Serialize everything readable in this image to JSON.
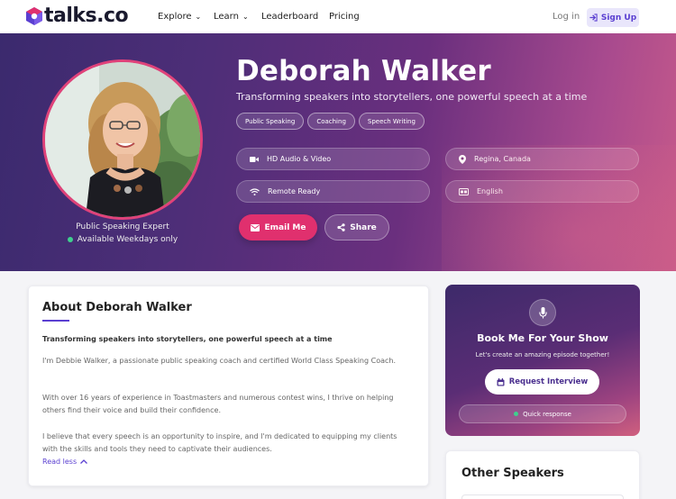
{
  "nav": {
    "logo_text": "talks.co",
    "links": [
      {
        "label": "Explore",
        "has_dropdown": true
      },
      {
        "label": "Learn",
        "has_dropdown": true
      },
      {
        "label": "Leaderboard",
        "has_dropdown": false
      },
      {
        "label": "Pricing",
        "has_dropdown": false
      }
    ],
    "login_label": "Log in",
    "signup_label": "Sign Up"
  },
  "hero": {
    "name": "Deborah Walker",
    "tagline": "Transforming speakers into storytellers, one powerful speech at a time",
    "tags": [
      "Public Speaking",
      "Coaching",
      "Speech Writing"
    ],
    "info": {
      "media": "HD Audio & Video",
      "location": "Regina, Canada",
      "remote": "Remote Ready",
      "language": "English"
    },
    "role": "Public Speaking Expert",
    "availability": "Available Weekdays only",
    "email_label": "Email Me",
    "share_label": "Share"
  },
  "about": {
    "title": "About Deborah Walker",
    "lead": "Transforming speakers into storytellers, one powerful speech at a time",
    "paragraphs": [
      "I'm Debbie Walker, a passionate public speaking coach and certified World Class Speaking Coach.",
      "With over 16 years of experience in Toastmasters and numerous contest wins, I thrive on helping others find their voice and build their confidence.",
      "I believe that every speech is an opportunity to inspire, and I'm dedicated to equipping my clients with the skills and tools they need to captivate their audiences."
    ],
    "read_less_label": "Read less"
  },
  "book": {
    "title": "Book Me For Your Show",
    "subtitle": "Let's create an amazing episode together!",
    "request_label": "Request Interview",
    "quick_label": "Quick response"
  },
  "other": {
    "title": "Other Speakers"
  },
  "colors": {
    "accent": "#5a3fd1",
    "email_button": "#e0306e",
    "available_dot": "#3fcf8e"
  }
}
